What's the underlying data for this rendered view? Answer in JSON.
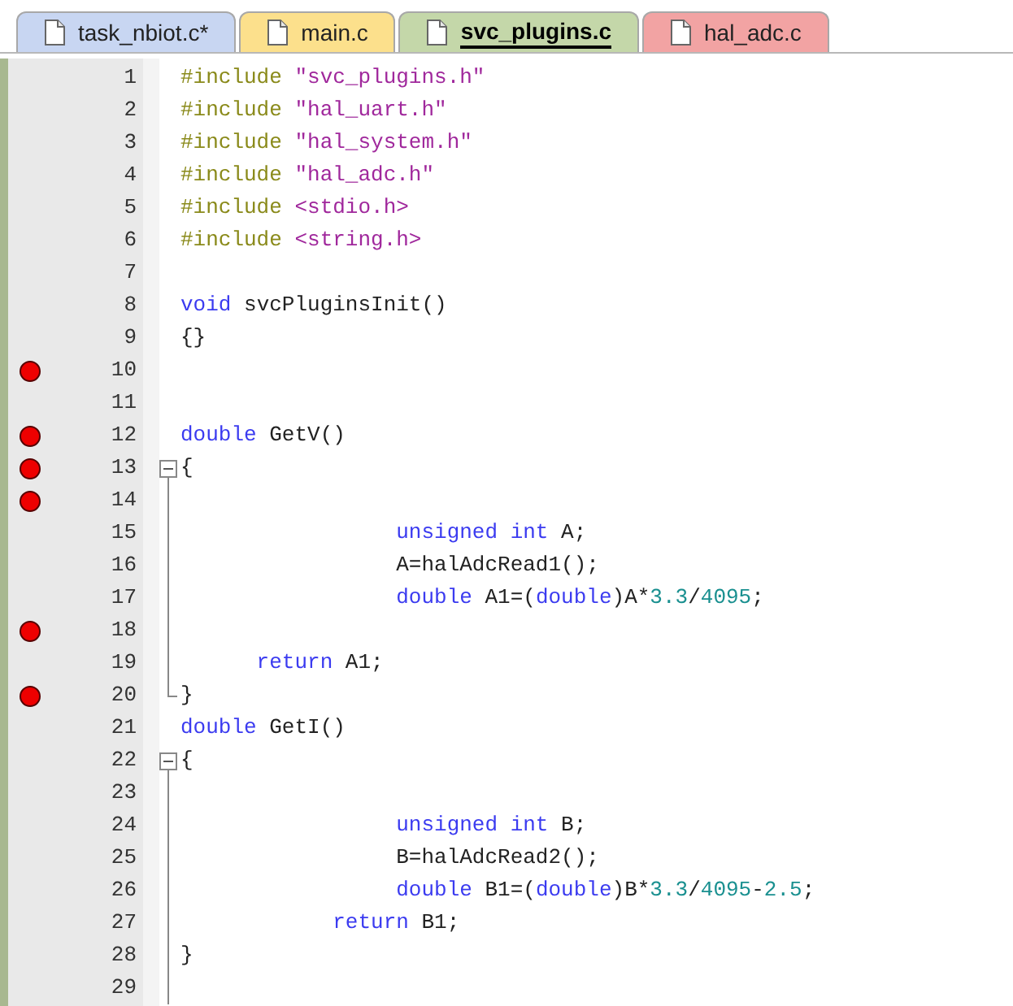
{
  "tabs": [
    {
      "label": "task_nbiot.c*",
      "selected": false,
      "color": "#c8d6f2"
    },
    {
      "label": "main.c",
      "selected": false,
      "color": "#fce08c"
    },
    {
      "label": "svc_plugins.c",
      "selected": true,
      "color": "#c4d7a9"
    },
    {
      "label": "hal_adc.c",
      "selected": false,
      "color": "#f2a3a3"
    }
  ],
  "lines": [
    {
      "number": "1",
      "breakpoint": false,
      "tokens": [
        {
          "kind": "preproc",
          "text": "#include "
        },
        {
          "kind": "string",
          "text": "\"svc_plugins.h\""
        }
      ]
    },
    {
      "number": "2",
      "breakpoint": false,
      "tokens": [
        {
          "kind": "preproc",
          "text": "#include "
        },
        {
          "kind": "string",
          "text": "\"hal_uart.h\""
        }
      ]
    },
    {
      "number": "3",
      "breakpoint": false,
      "tokens": [
        {
          "kind": "preproc",
          "text": "#include "
        },
        {
          "kind": "string",
          "text": "\"hal_system.h\""
        }
      ]
    },
    {
      "number": "4",
      "breakpoint": false,
      "tokens": [
        {
          "kind": "preproc",
          "text": "#include "
        },
        {
          "kind": "string",
          "text": "\"hal_adc.h\""
        }
      ]
    },
    {
      "number": "5",
      "breakpoint": false,
      "tokens": [
        {
          "kind": "preproc",
          "text": "#include "
        },
        {
          "kind": "string",
          "text": "<stdio.h>"
        }
      ]
    },
    {
      "number": "6",
      "breakpoint": false,
      "tokens": [
        {
          "kind": "preproc",
          "text": "#include "
        },
        {
          "kind": "string",
          "text": "<string.h>"
        }
      ]
    },
    {
      "number": "7",
      "breakpoint": false
    },
    {
      "number": "8",
      "breakpoint": false,
      "tokens": [
        {
          "kind": "keyword",
          "text": "void"
        },
        {
          "kind": "plain",
          "text": " svcPluginsInit()"
        }
      ]
    },
    {
      "number": "9",
      "breakpoint": false,
      "tokens": [
        {
          "kind": "plain",
          "text": "{}"
        }
      ]
    },
    {
      "number": "10",
      "breakpoint": true
    },
    {
      "number": "11",
      "breakpoint": false
    },
    {
      "number": "12",
      "breakpoint": true,
      "tokens": [
        {
          "kind": "keyword",
          "text": "double"
        },
        {
          "kind": "plain",
          "text": " GetV()"
        }
      ]
    },
    {
      "number": "13",
      "breakpoint": true,
      "fold_start": true,
      "tokens": [
        {
          "kind": "plain",
          "text": "{"
        }
      ]
    },
    {
      "number": "14",
      "breakpoint": true,
      "fold_line": true
    },
    {
      "number": "15",
      "breakpoint": false,
      "fold_line": true,
      "tokens": [
        {
          "kind": "keyword",
          "text": "                 unsigned int"
        },
        {
          "kind": "plain",
          "text": " A;"
        }
      ]
    },
    {
      "number": "16",
      "breakpoint": false,
      "fold_line": true,
      "tokens": [
        {
          "kind": "plain",
          "text": "                 A=halAdcRead1();"
        }
      ]
    },
    {
      "number": "17",
      "breakpoint": false,
      "fold_line": true,
      "tokens": [
        {
          "kind": "keyword",
          "text": "                 double"
        },
        {
          "kind": "plain",
          "text": " A1=("
        },
        {
          "kind": "keyword",
          "text": "double"
        },
        {
          "kind": "plain",
          "text": ")A*"
        },
        {
          "kind": "number",
          "text": "3.3"
        },
        {
          "kind": "plain",
          "text": "/"
        },
        {
          "kind": "number",
          "text": "4095"
        },
        {
          "kind": "plain",
          "text": ";"
        }
      ]
    },
    {
      "number": "18",
      "breakpoint": true,
      "fold_line": true
    },
    {
      "number": "19",
      "breakpoint": false,
      "fold_line": true,
      "tokens": [
        {
          "kind": "keyword",
          "text": "      return"
        },
        {
          "kind": "plain",
          "text": " A1;"
        }
      ]
    },
    {
      "number": "20",
      "breakpoint": true,
      "fold_end": true,
      "tokens": [
        {
          "kind": "plain",
          "text": "}"
        }
      ]
    },
    {
      "number": "21",
      "breakpoint": false,
      "tokens": [
        {
          "kind": "keyword",
          "text": "double"
        },
        {
          "kind": "plain",
          "text": " GetI()"
        }
      ]
    },
    {
      "number": "22",
      "breakpoint": false,
      "fold_start": true,
      "tokens": [
        {
          "kind": "plain",
          "text": "{"
        }
      ]
    },
    {
      "number": "23",
      "breakpoint": false,
      "fold_line": true
    },
    {
      "number": "24",
      "breakpoint": false,
      "fold_line": true,
      "tokens": [
        {
          "kind": "keyword",
          "text": "                 unsigned int"
        },
        {
          "kind": "plain",
          "text": " B;"
        }
      ]
    },
    {
      "number": "25",
      "breakpoint": false,
      "fold_line": true,
      "tokens": [
        {
          "kind": "plain",
          "text": "                 B=halAdcRead2();"
        }
      ]
    },
    {
      "number": "26",
      "breakpoint": false,
      "fold_line": true,
      "tokens": [
        {
          "kind": "keyword",
          "text": "                 double"
        },
        {
          "kind": "plain",
          "text": " B1=("
        },
        {
          "kind": "keyword",
          "text": "double"
        },
        {
          "kind": "plain",
          "text": ")B*"
        },
        {
          "kind": "number",
          "text": "3.3"
        },
        {
          "kind": "plain",
          "text": "/"
        },
        {
          "kind": "number",
          "text": "4095"
        },
        {
          "kind": "plain",
          "text": "-"
        },
        {
          "kind": "number",
          "text": "2.5"
        },
        {
          "kind": "plain",
          "text": ";"
        }
      ]
    },
    {
      "number": "27",
      "breakpoint": false,
      "fold_line": true,
      "tokens": [
        {
          "kind": "keyword",
          "text": "            return"
        },
        {
          "kind": "plain",
          "text": " B1;"
        }
      ]
    },
    {
      "number": "28",
      "breakpoint": false,
      "fold_line": true,
      "tokens": [
        {
          "kind": "plain",
          "text": "}"
        }
      ]
    },
    {
      "number": "29",
      "breakpoint": false,
      "fold_line": true
    }
  ]
}
